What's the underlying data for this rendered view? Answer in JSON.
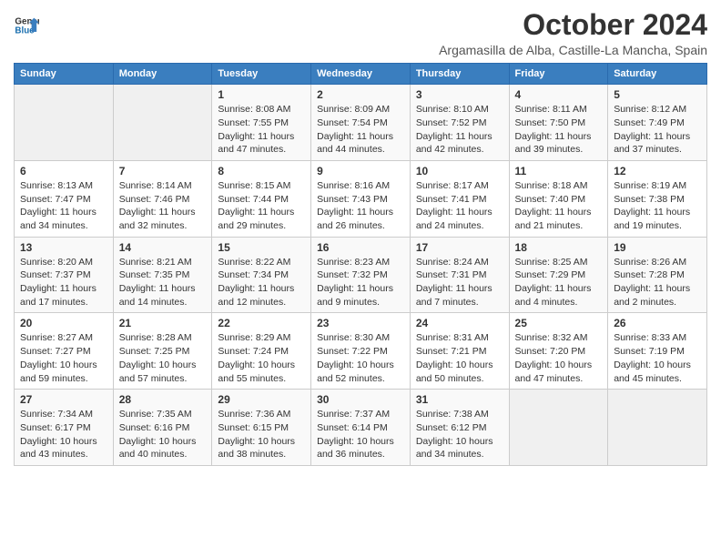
{
  "header": {
    "logo_line1": "General",
    "logo_line2": "Blue",
    "month": "October 2024",
    "location": "Argamasilla de Alba, Castille-La Mancha, Spain"
  },
  "weekdays": [
    "Sunday",
    "Monday",
    "Tuesday",
    "Wednesday",
    "Thursday",
    "Friday",
    "Saturday"
  ],
  "weeks": [
    [
      {
        "day": "",
        "details": ""
      },
      {
        "day": "",
        "details": ""
      },
      {
        "day": "1",
        "details": "Sunrise: 8:08 AM\nSunset: 7:55 PM\nDaylight: 11 hours and 47 minutes."
      },
      {
        "day": "2",
        "details": "Sunrise: 8:09 AM\nSunset: 7:54 PM\nDaylight: 11 hours and 44 minutes."
      },
      {
        "day": "3",
        "details": "Sunrise: 8:10 AM\nSunset: 7:52 PM\nDaylight: 11 hours and 42 minutes."
      },
      {
        "day": "4",
        "details": "Sunrise: 8:11 AM\nSunset: 7:50 PM\nDaylight: 11 hours and 39 minutes."
      },
      {
        "day": "5",
        "details": "Sunrise: 8:12 AM\nSunset: 7:49 PM\nDaylight: 11 hours and 37 minutes."
      }
    ],
    [
      {
        "day": "6",
        "details": "Sunrise: 8:13 AM\nSunset: 7:47 PM\nDaylight: 11 hours and 34 minutes."
      },
      {
        "day": "7",
        "details": "Sunrise: 8:14 AM\nSunset: 7:46 PM\nDaylight: 11 hours and 32 minutes."
      },
      {
        "day": "8",
        "details": "Sunrise: 8:15 AM\nSunset: 7:44 PM\nDaylight: 11 hours and 29 minutes."
      },
      {
        "day": "9",
        "details": "Sunrise: 8:16 AM\nSunset: 7:43 PM\nDaylight: 11 hours and 26 minutes."
      },
      {
        "day": "10",
        "details": "Sunrise: 8:17 AM\nSunset: 7:41 PM\nDaylight: 11 hours and 24 minutes."
      },
      {
        "day": "11",
        "details": "Sunrise: 8:18 AM\nSunset: 7:40 PM\nDaylight: 11 hours and 21 minutes."
      },
      {
        "day": "12",
        "details": "Sunrise: 8:19 AM\nSunset: 7:38 PM\nDaylight: 11 hours and 19 minutes."
      }
    ],
    [
      {
        "day": "13",
        "details": "Sunrise: 8:20 AM\nSunset: 7:37 PM\nDaylight: 11 hours and 17 minutes."
      },
      {
        "day": "14",
        "details": "Sunrise: 8:21 AM\nSunset: 7:35 PM\nDaylight: 11 hours and 14 minutes."
      },
      {
        "day": "15",
        "details": "Sunrise: 8:22 AM\nSunset: 7:34 PM\nDaylight: 11 hours and 12 minutes."
      },
      {
        "day": "16",
        "details": "Sunrise: 8:23 AM\nSunset: 7:32 PM\nDaylight: 11 hours and 9 minutes."
      },
      {
        "day": "17",
        "details": "Sunrise: 8:24 AM\nSunset: 7:31 PM\nDaylight: 11 hours and 7 minutes."
      },
      {
        "day": "18",
        "details": "Sunrise: 8:25 AM\nSunset: 7:29 PM\nDaylight: 11 hours and 4 minutes."
      },
      {
        "day": "19",
        "details": "Sunrise: 8:26 AM\nSunset: 7:28 PM\nDaylight: 11 hours and 2 minutes."
      }
    ],
    [
      {
        "day": "20",
        "details": "Sunrise: 8:27 AM\nSunset: 7:27 PM\nDaylight: 10 hours and 59 minutes."
      },
      {
        "day": "21",
        "details": "Sunrise: 8:28 AM\nSunset: 7:25 PM\nDaylight: 10 hours and 57 minutes."
      },
      {
        "day": "22",
        "details": "Sunrise: 8:29 AM\nSunset: 7:24 PM\nDaylight: 10 hours and 55 minutes."
      },
      {
        "day": "23",
        "details": "Sunrise: 8:30 AM\nSunset: 7:22 PM\nDaylight: 10 hours and 52 minutes."
      },
      {
        "day": "24",
        "details": "Sunrise: 8:31 AM\nSunset: 7:21 PM\nDaylight: 10 hours and 50 minutes."
      },
      {
        "day": "25",
        "details": "Sunrise: 8:32 AM\nSunset: 7:20 PM\nDaylight: 10 hours and 47 minutes."
      },
      {
        "day": "26",
        "details": "Sunrise: 8:33 AM\nSunset: 7:19 PM\nDaylight: 10 hours and 45 minutes."
      }
    ],
    [
      {
        "day": "27",
        "details": "Sunrise: 7:34 AM\nSunset: 6:17 PM\nDaylight: 10 hours and 43 minutes."
      },
      {
        "day": "28",
        "details": "Sunrise: 7:35 AM\nSunset: 6:16 PM\nDaylight: 10 hours and 40 minutes."
      },
      {
        "day": "29",
        "details": "Sunrise: 7:36 AM\nSunset: 6:15 PM\nDaylight: 10 hours and 38 minutes."
      },
      {
        "day": "30",
        "details": "Sunrise: 7:37 AM\nSunset: 6:14 PM\nDaylight: 10 hours and 36 minutes."
      },
      {
        "day": "31",
        "details": "Sunrise: 7:38 AM\nSunset: 6:12 PM\nDaylight: 10 hours and 34 minutes."
      },
      {
        "day": "",
        "details": ""
      },
      {
        "day": "",
        "details": ""
      }
    ]
  ]
}
